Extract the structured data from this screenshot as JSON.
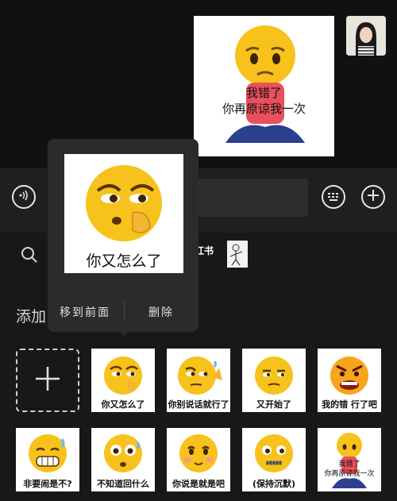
{
  "chat": {
    "sent_sticker": {
      "line1": "我错了",
      "line2": "你再原谅我一次"
    }
  },
  "input_bar": {
    "voice_icon": "voice-icon",
    "emoji_icon": "emoji-keyboard-icon",
    "add_icon": "plus-icon"
  },
  "panel": {
    "search_icon": "search-icon",
    "tag_xiaohongshu": "小红书",
    "add_label": "添加",
    "stickers": [
      {
        "caption": "你又怎么了"
      },
      {
        "caption": "你别说话就行了"
      },
      {
        "caption": "又开始了"
      },
      {
        "caption": "我的错 行了吧"
      },
      {
        "caption": "非要闹是不?"
      },
      {
        "caption": "不知道回什么"
      },
      {
        "caption": "你说是就是吧"
      },
      {
        "caption": "(保持沉默)"
      },
      {
        "caption_line1": "我错了",
        "caption_line2": "你再原谅我一次"
      }
    ]
  },
  "popup": {
    "preview_caption": "你又怎么了",
    "move_front_label": "移到前面",
    "delete_label": "删除"
  },
  "colors": {
    "emoji_yellow": "#f7c21b",
    "background": "#171717"
  }
}
